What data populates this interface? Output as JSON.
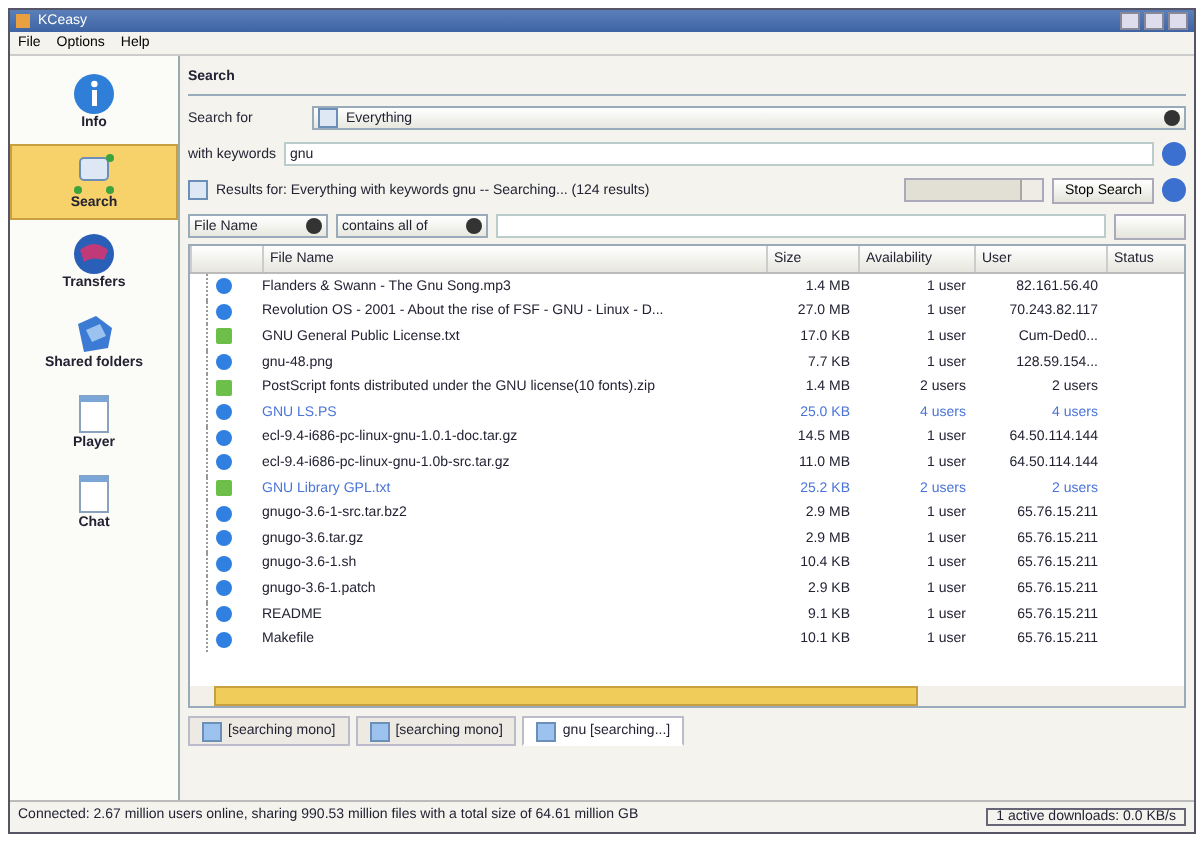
{
  "window": {
    "title": "KCeasy"
  },
  "menu": [
    "File",
    "Options",
    "Help"
  ],
  "sidebar": [
    {
      "label": "Info",
      "kind": "info",
      "selected": false
    },
    {
      "label": "Search",
      "kind": "search",
      "selected": true
    },
    {
      "label": "Transfers",
      "kind": "transfers",
      "selected": false
    },
    {
      "label": "Shared folders",
      "kind": "shared",
      "selected": false
    },
    {
      "label": "Player",
      "kind": "player",
      "selected": false
    },
    {
      "label": "Chat",
      "kind": "chat",
      "selected": false
    }
  ],
  "search": {
    "heading": "Search",
    "search_for_label": "Search for",
    "search_for_value": "Everything",
    "keywords_label": "with keywords",
    "keywords_value": "gnu",
    "results_text": "Results for: Everything with keywords gnu -- Searching... (124 results)",
    "progress": {
      "level": 0.85
    },
    "stop_button": "Stop Search"
  },
  "filter": {
    "field": "File Name",
    "mode": "contains all of"
  },
  "table": {
    "columns": [
      "File Name",
      "Size",
      "Availability",
      "User",
      "Status"
    ],
    "rows": [
      {
        "kind": "file",
        "highlighted": false,
        "cells": [
          "Flanders & Swann - The Gnu Song.mp3",
          "1.4 MB",
          "1 user",
          "82.161.56.40"
        ]
      },
      {
        "kind": "file",
        "highlighted": false,
        "cells": [
          "Revolution OS - 2001 - About the rise of FSF - GNU - Linux - D...",
          "27.0 MB",
          "1 user",
          "70.243.82.117"
        ]
      },
      {
        "kind": "document",
        "highlighted": false,
        "cells": [
          "GNU General Public License.txt",
          "17.0 KB",
          "1 user",
          "Cum-Ded0..."
        ]
      },
      {
        "kind": "file",
        "highlighted": false,
        "cells": [
          "gnu-48.png",
          "7.7 KB",
          "1 user",
          "128.59.154..."
        ]
      },
      {
        "kind": "document",
        "highlighted": false,
        "cells": [
          "PostScript fonts distributed under the GNU license(10 fonts).zip",
          "1.4 MB",
          "2 users",
          "2 users"
        ]
      },
      {
        "kind": "file",
        "highlighted": true,
        "cells": [
          "GNU LS.PS",
          "25.0 KB",
          "4 users",
          "4 users"
        ]
      },
      {
        "kind": "file",
        "highlighted": false,
        "cells": [
          "ecl-9.4-i686-pc-linux-gnu-1.0.1-doc.tar.gz",
          "14.5 MB",
          "1 user",
          "64.50.114.144"
        ]
      },
      {
        "kind": "file",
        "highlighted": false,
        "cells": [
          "ecl-9.4-i686-pc-linux-gnu-1.0b-src.tar.gz",
          "11.0 MB",
          "1 user",
          "64.50.114.144"
        ]
      },
      {
        "kind": "document",
        "highlighted": true,
        "cells": [
          "GNU Library GPL.txt",
          "25.2 KB",
          "2 users",
          "2 users"
        ]
      },
      {
        "kind": "file",
        "highlighted": false,
        "cells": [
          "gnugo-3.6-1-src.tar.bz2",
          "2.9 MB",
          "1 user",
          "65.76.15.211"
        ]
      },
      {
        "kind": "file",
        "highlighted": false,
        "cells": [
          "gnugo-3.6.tar.gz",
          "2.9 MB",
          "1 user",
          "65.76.15.211"
        ]
      },
      {
        "kind": "file",
        "highlighted": false,
        "cells": [
          "gnugo-3.6-1.sh",
          "10.4 KB",
          "1 user",
          "65.76.15.211"
        ]
      },
      {
        "kind": "file",
        "highlighted": false,
        "cells": [
          "gnugo-3.6-1.patch",
          "2.9 KB",
          "1 user",
          "65.76.15.211"
        ]
      },
      {
        "kind": "file",
        "highlighted": false,
        "cells": [
          "README",
          "9.1 KB",
          "1 user",
          "65.76.15.211"
        ]
      },
      {
        "kind": "file",
        "highlighted": false,
        "cells": [
          "Makefile",
          "10.1 KB",
          "1 user",
          "65.76.15.211"
        ]
      }
    ]
  },
  "tabs": [
    {
      "label": "[searching mono]",
      "selected": false
    },
    {
      "label": "[searching mono]",
      "selected": false
    },
    {
      "label": "gnu [searching...]",
      "selected": true
    }
  ],
  "status_bar": {
    "message": "Connected: 2.67 million users online, sharing 990.53 million files with a total size of 64.61 million GB",
    "downloads": "1 active downloads: 0.0 KB/s"
  }
}
